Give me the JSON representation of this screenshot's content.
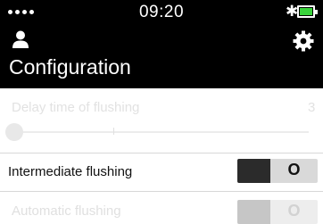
{
  "status_bar": {
    "signal_dots": 4,
    "time": "09:20",
    "bluetooth_icon": "bluetooth-icon",
    "battery_icon": "battery-icon",
    "battery_color": "#39d33b"
  },
  "header": {
    "title": "Configuration",
    "left_icon": "user-icon",
    "right_icon": "gear-icon"
  },
  "settings": {
    "delay": {
      "label": "Delay time of flushing",
      "value": "3",
      "slider_level": 0,
      "enabled": false
    },
    "intermediate": {
      "label": "Intermediate flushing",
      "toggle_text": "O",
      "enabled": true
    },
    "automatic": {
      "label": "Automatic flushing",
      "toggle_text": "O",
      "enabled": false
    }
  }
}
